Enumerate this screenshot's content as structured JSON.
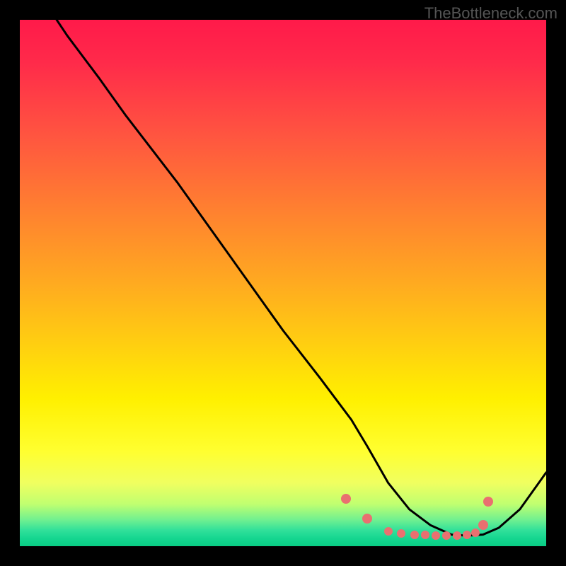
{
  "watermark": "TheBottleneck.com",
  "chart_data": {
    "type": "line",
    "title": "",
    "xlabel": "",
    "ylabel": "",
    "xlim": [
      0,
      100
    ],
    "ylim": [
      0,
      100
    ],
    "series": [
      {
        "name": "curve",
        "x": [
          7,
          9,
          12,
          15,
          20,
          30,
          40,
          50,
          57,
          60,
          63,
          66,
          70,
          74,
          78,
          82,
          85,
          88,
          91,
          95,
          100
        ],
        "y": [
          100,
          97,
          93,
          89,
          82,
          69,
          55,
          41,
          32,
          28,
          24,
          19,
          12,
          7,
          4,
          2.2,
          2.0,
          2.2,
          3.5,
          7,
          14
        ]
      }
    ],
    "markers": {
      "name": "highlight-dots",
      "color": "#e97070",
      "points": [
        {
          "x": 62,
          "y": 9.0,
          "r": 7
        },
        {
          "x": 66,
          "y": 5.2,
          "r": 7
        },
        {
          "x": 70,
          "y": 2.8,
          "r": 6
        },
        {
          "x": 72.5,
          "y": 2.4,
          "r": 6
        },
        {
          "x": 75,
          "y": 2.2,
          "r": 6
        },
        {
          "x": 77,
          "y": 2.1,
          "r": 6
        },
        {
          "x": 79,
          "y": 2.0,
          "r": 6
        },
        {
          "x": 81,
          "y": 2.0,
          "r": 6
        },
        {
          "x": 83,
          "y": 2.0,
          "r": 6
        },
        {
          "x": 85,
          "y": 2.1,
          "r": 6
        },
        {
          "x": 86.5,
          "y": 2.5,
          "r": 6
        },
        {
          "x": 88,
          "y": 4.0,
          "r": 7
        },
        {
          "x": 89,
          "y": 8.5,
          "r": 7
        }
      ]
    },
    "gradient_stops": [
      {
        "pos": 0,
        "color": "#ff1a4a"
      },
      {
        "pos": 50,
        "color": "#ffaa20"
      },
      {
        "pos": 80,
        "color": "#ffff30"
      },
      {
        "pos": 100,
        "color": "#0acd85"
      }
    ]
  }
}
